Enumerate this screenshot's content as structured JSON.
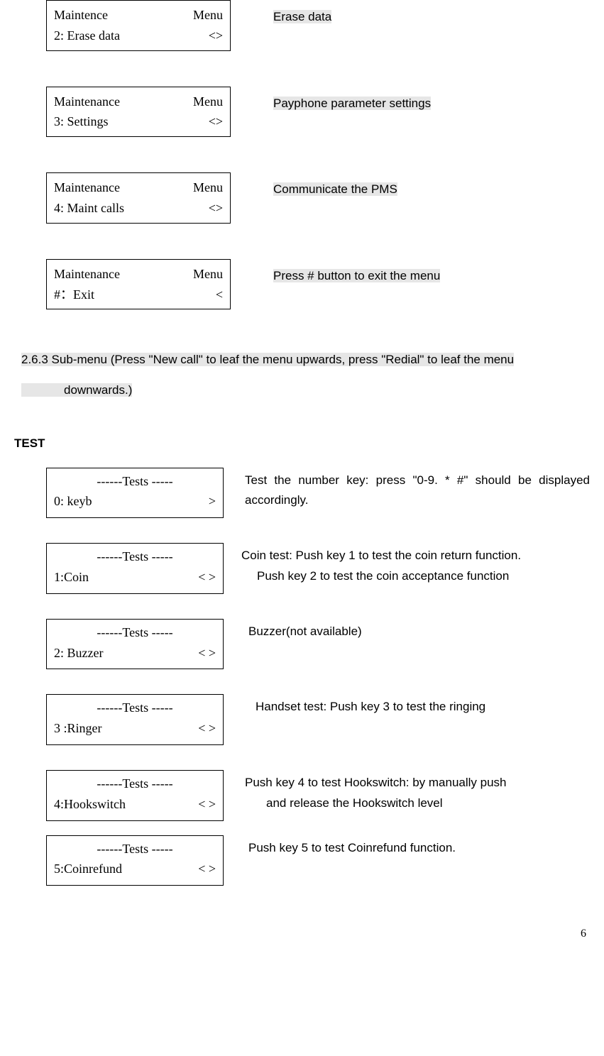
{
  "menus": [
    {
      "title_left": "Maintence",
      "title_right": "Menu",
      "item_left": "2: Erase    data",
      "item_right": "<>",
      "desc": "Erase data"
    },
    {
      "title_left": "Maintenance",
      "title_right": "Menu",
      "item_left": "3: Settings",
      "item_right": "<>",
      "desc": "Payphone parameter settings  "
    },
    {
      "title_left": "Maintenance",
      "title_right": "Menu",
      "item_left": "4: Maint    calls",
      "item_right": "<>",
      "desc": "Communicate the PMS"
    },
    {
      "title_left": "Maintenance",
      "title_right": "Menu",
      "item_left": "#：Exit",
      "item_right": "<",
      "desc": "Press # button to exit the menu"
    }
  ],
  "section_heading_1": "2.6.3 Sub-menu (Press \"New call\" to leaf the menu upwards, press \"Redial\" to leaf the menu",
  "section_heading_2": "downwards.)",
  "test_heading": "TEST",
  "tests": [
    {
      "title": "------Tests -----",
      "item_left": "0: keyb",
      "item_right": ">",
      "desc": "Test the number key: press \"0-9. * #\" should be displayed accordingly.",
      "desc_mode": "justify"
    },
    {
      "title": "------Tests -----",
      "item_left": "1:Coin",
      "item_right": "< >",
      "desc_line1": "Coin test: Push key 1 to test the coin return function.",
      "desc_line2": "Push key 2 to test the coin acceptance function",
      "desc_mode": "two-line"
    },
    {
      "title": "------Tests -----",
      "item_left": "2: Buzzer",
      "item_right": "< >",
      "desc": "Buzzer(not available)",
      "desc_mode": "single"
    },
    {
      "title": "------Tests -----",
      "item_left": "3 :Ringer",
      "item_right": "< >",
      "desc": "Handset test: Push key 3 to test the ringing",
      "desc_mode": "single"
    },
    {
      "title": "------Tests -----",
      "item_left": "4:Hookswitch",
      "item_right": "< >",
      "desc_line1": "Push key 4 to test Hookswitch: by manually push",
      "desc_line2": "and release the Hookswitch level",
      "desc_mode": "two-line"
    },
    {
      "title": "------Tests -----",
      "item_left": "5:Coinrefund",
      "item_right": "< >",
      "desc": "Push key 5 to test Coinrefund function.",
      "desc_mode": "single"
    }
  ],
  "page_number": "6"
}
